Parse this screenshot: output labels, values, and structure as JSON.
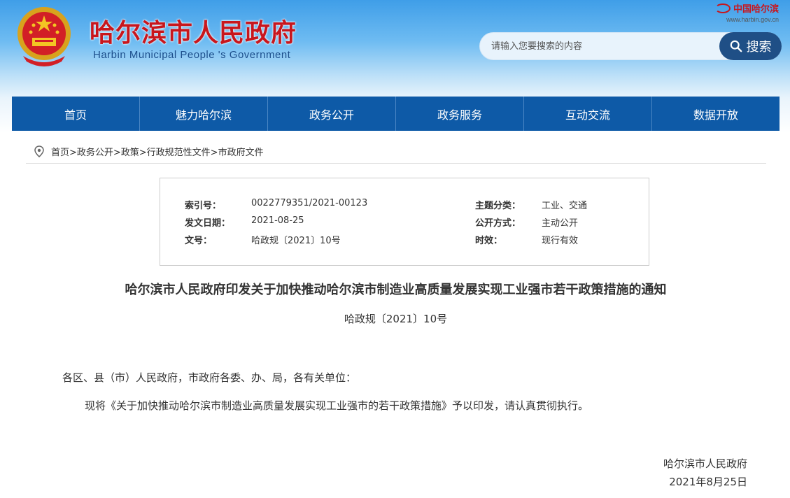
{
  "header": {
    "title": "哈尔滨市人民政府",
    "subtitle": "Harbin Municipal People 's Government",
    "logo_text": "中国哈尔滨",
    "logo_url": "www.harbin.gov.cn"
  },
  "search": {
    "placeholder": "请输入您要搜索的内容",
    "button_label": "搜索"
  },
  "nav": {
    "items": [
      "首页",
      "魅力哈尔滨",
      "政务公开",
      "政务服务",
      "互动交流",
      "数据开放"
    ]
  },
  "breadcrumb": {
    "text": "首页>政务公开>政策>行政规范性文件>市政府文件"
  },
  "meta": {
    "index_label": "索引号：",
    "index_value": "0022779351/2021-00123",
    "date_label": "发文日期：",
    "date_value": "2021-08-25",
    "docno_label": "文号：",
    "docno_value": "哈政规〔2021〕10号",
    "topic_label": "主题分类：",
    "topic_value": "工业、交通",
    "disclosure_label": "公开方式：",
    "disclosure_value": "主动公开",
    "validity_label": "时效：",
    "validity_value": "现行有效"
  },
  "document": {
    "title": "哈尔滨市人民政府印发关于加快推动哈尔滨市制造业高质量发展实现工业强市若干政策措施的通知",
    "number": "哈政规〔2021〕10号",
    "salutation": "各区、县（市）人民政府，市政府各委、办、局，各有关单位：",
    "body": "现将《关于加快推动哈尔滨市制造业高质量发展实现工业强市的若干政策措施》予以印发，请认真贯彻执行。",
    "signature": "哈尔滨市人民政府",
    "date": "2021年8月25日"
  },
  "colors": {
    "nav_bg": "#0e5aa7",
    "title_red": "#c8161d",
    "search_button": "#1f4f86"
  }
}
